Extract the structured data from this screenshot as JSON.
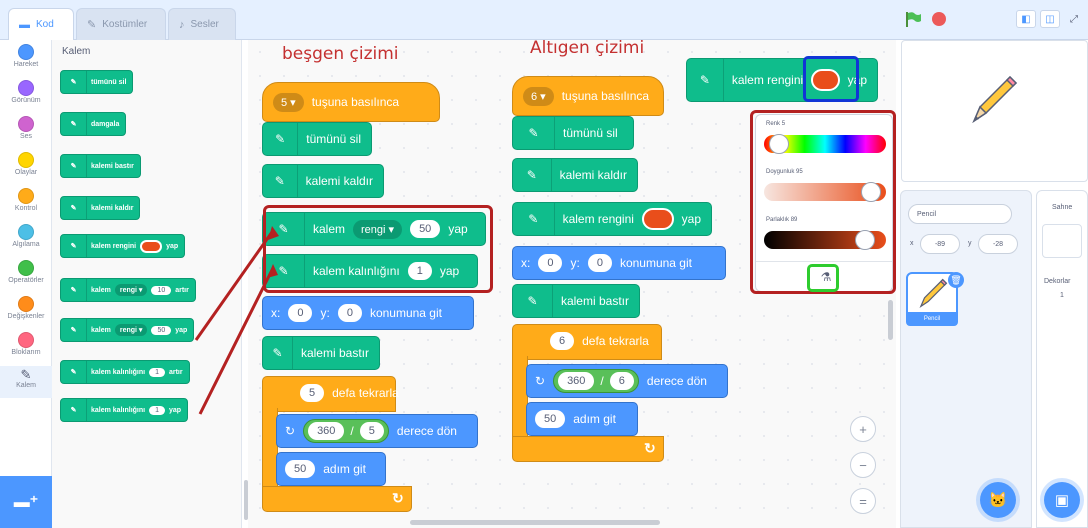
{
  "tabs": [
    {
      "label": "Kod",
      "icon": "code-icon"
    },
    {
      "label": "Kostümler",
      "icon": "brush-icon"
    },
    {
      "label": "Sesler",
      "icon": "sound-icon"
    }
  ],
  "categories": [
    {
      "label": "Hareket",
      "color": "#4c97ff"
    },
    {
      "label": "Görünüm",
      "color": "#9966ff"
    },
    {
      "label": "Ses",
      "color": "#cf63cf"
    },
    {
      "label": "Olaylar",
      "color": "#ffd500"
    },
    {
      "label": "Kontrol",
      "color": "#ffab19"
    },
    {
      "label": "Algılama",
      "color": "#4cbfe6"
    },
    {
      "label": "Operatörler",
      "color": "#40bf4a"
    },
    {
      "label": "Değişkenler",
      "color": "#ff8c1a"
    },
    {
      "label": "Bloklarım",
      "color": "#ff6680"
    },
    {
      "label": "Kalem",
      "color": "#0fbd8c"
    }
  ],
  "palette": {
    "title": "Kalem",
    "blocks": {
      "erase_all": "tümünü sil",
      "stamp": "damgala",
      "pen_down": "kalemi bastır",
      "pen_up": "kalemi kaldır",
      "set_color_pre": "kalem rengini",
      "set_color_post": "yap",
      "change_pre": "kalem",
      "change_dd": "rengi ▾",
      "change_num": "10",
      "change_post": "artır",
      "setparam_pre": "kalem",
      "setparam_dd": "rengi ▾",
      "setparam_num": "50",
      "setparam_post": "yap",
      "change_size_pre": "kalem kalınlığını",
      "change_size_num": "1",
      "change_size_post": "artır",
      "set_size_pre": "kalem kalınlığını",
      "set_size_num": "1",
      "set_size_post": "yap"
    }
  },
  "headings": {
    "pentagon": "beşgen çizimi",
    "hexagon": "Altıgen çizimi"
  },
  "pentagon": {
    "key": "5 ▾",
    "hat_text": "tuşuna basılınca",
    "erase": "tümünü sil",
    "penup": "kalemi kaldır",
    "set_pre": "kalem",
    "set_dd": "rengi ▾",
    "set_num": "50",
    "set_post": "yap",
    "size_pre": "kalem kalınlığını",
    "size_num": "1",
    "size_post": "yap",
    "goto_x_lbl": "x:",
    "goto_x": "0",
    "goto_y_lbl": "y:",
    "goto_y": "0",
    "goto_post": "konumuna git",
    "pendown": "kalemi bastır",
    "repeat_num": "5",
    "repeat_post": "defa tekrarla",
    "turn_a": "360",
    "turn_op": "/",
    "turn_b": "5",
    "turn_post": "derece dön",
    "move_num": "50",
    "move_post": "adım git",
    "loop_end": "↻"
  },
  "hexagon": {
    "key": "6 ▾",
    "hat_text": "tuşuna basılınca",
    "erase": "tümünü sil",
    "penup": "kalemi kaldır",
    "color_pre": "kalem rengini",
    "color_post": "yap",
    "goto_x_lbl": "x:",
    "goto_x": "0",
    "goto_y_lbl": "y:",
    "goto_y": "0",
    "goto_post": "konumuna git",
    "pendown": "kalemi bastır",
    "repeat_num": "6",
    "repeat_post": "defa tekrarla",
    "turn_a": "360",
    "turn_op": "/",
    "turn_b": "6",
    "turn_post": "derece dön",
    "move_num": "50",
    "move_post": "adım git",
    "loop_end": "↻"
  },
  "floating": {
    "pre": "kalem rengini",
    "post": "yap"
  },
  "picker": {
    "hue_label": "Renk",
    "hue_value": "5",
    "hue": 0.05,
    "sat_label": "Doygunluk",
    "sat_value": "95",
    "sat": 0.95,
    "bri_label": "Parlaklık",
    "bri_value": "89",
    "bri": 0.89
  },
  "sprite": {
    "name_label": "Pencil",
    "x_lbl": "x",
    "x": "-89",
    "y_lbl": "y",
    "y": "-28",
    "thumb_name": "Pencil"
  },
  "stage_pane": {
    "title": "Sahne",
    "backdrops_label": "Dekorlar",
    "backdrops_count": "1"
  },
  "zoom": {
    "in": "+",
    "out": "−",
    "reset": "="
  },
  "colors": {
    "pen": "#0fbd8c",
    "motion": "#4c97ff",
    "control": "#ffab19",
    "operator": "#59c059",
    "pen_color": "#e94e1b",
    "annotation": "#b42121"
  }
}
